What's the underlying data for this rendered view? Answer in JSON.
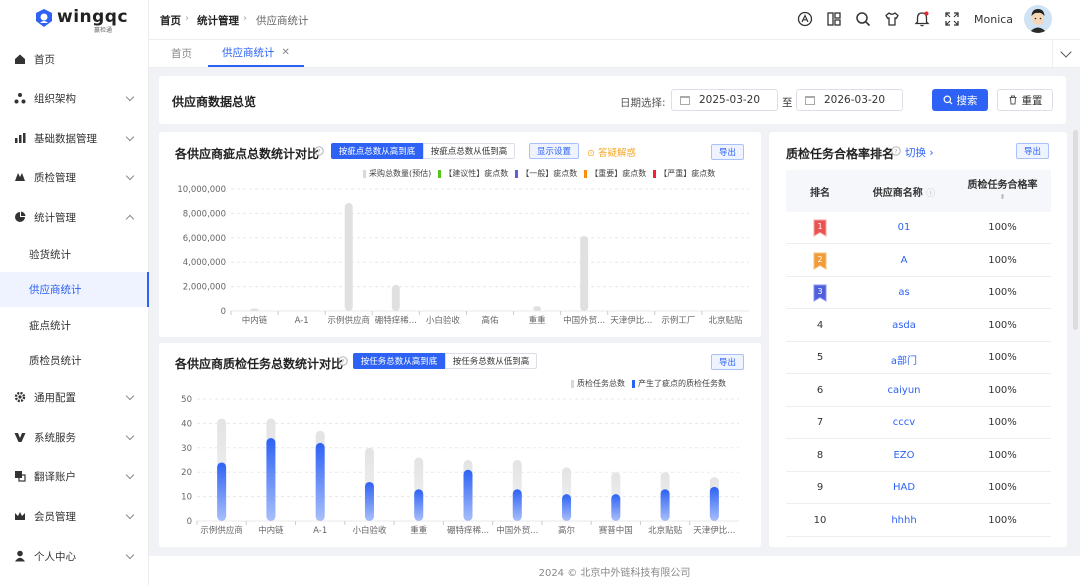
{
  "app": {
    "logo_text": "wingqc",
    "logo_sub": "赢检通"
  },
  "sidebar": {
    "items": [
      {
        "label": "首页",
        "icon": "home-icon"
      },
      {
        "label": "组织架构",
        "icon": "org-icon"
      },
      {
        "label": "基础数据管理",
        "icon": "bar-chart-icon"
      },
      {
        "label": "质检管理",
        "icon": "inspection-icon"
      },
      {
        "label": "统计管理",
        "icon": "pie-chart-icon"
      },
      {
        "label": "通用配置",
        "icon": "gear-icon"
      },
      {
        "label": "系统服务",
        "icon": "service-icon"
      },
      {
        "label": "翻译账户",
        "icon": "translate-icon"
      },
      {
        "label": "会员管理",
        "icon": "crown-icon"
      },
      {
        "label": "个人中心",
        "icon": "user-icon"
      }
    ],
    "sub_items": [
      "验货统计",
      "供应商统计",
      "疵点统计",
      "质检员统计"
    ]
  },
  "topbar": {
    "breadcrumb": [
      "首页",
      "统计管理",
      "供应商统计"
    ],
    "user_name": "Monica"
  },
  "tabs": [
    {
      "label": "首页"
    },
    {
      "label": "供应商统计"
    }
  ],
  "filter": {
    "title": "供应商数据总览",
    "date_label": "日期选择:",
    "start_date": "2025-03-20",
    "to": "至",
    "end_date": "2026-03-20",
    "search_label": "搜索",
    "reset_label": "重置"
  },
  "defect_chart": {
    "title": "各供应商疵点总数统计对比",
    "sort_desc": "按疵点总数从高到底",
    "sort_asc": "按疵点总数从低到高",
    "settings_label": "显示设置",
    "help_label": "答疑解惑",
    "export_label": "导出",
    "legend": [
      {
        "name": "采购总数量(预估)",
        "color": "#d9d9d9"
      },
      {
        "name": "【建议性】疵点数",
        "color": "#52c41a"
      },
      {
        "name": "【一般】疵点数",
        "color": "#5b5fd9"
      },
      {
        "name": "【重要】疵点数",
        "color": "#fa8c16"
      },
      {
        "name": "【严重】疵点数",
        "color": "#f5222d"
      }
    ]
  },
  "task_chart": {
    "title": "各供应商质检任务总数统计对比",
    "sort_desc": "按任务总数从高到底",
    "sort_asc": "按任务总数从低到高",
    "export_label": "导出",
    "legend": [
      {
        "name": "质检任务总数",
        "color": "#d9d9d9"
      },
      {
        "name": "产生了疵点的质检任务数",
        "color": "#2d62f4"
      }
    ]
  },
  "chart_data": [
    {
      "type": "bar",
      "title": "各供应商疵点总数统计对比",
      "categories": [
        "中内链",
        "A-1",
        "示例供应商",
        "硼特痒稀...",
        "小白验收",
        "高佑",
        "重重",
        "中国外贸...",
        "天津伊比...",
        "示例工厂",
        "北京贴贴"
      ],
      "series": [
        {
          "name": "采购总数量(预估)",
          "values": [
            200000,
            0,
            8850000,
            2150000,
            0,
            0,
            400000,
            6150000,
            0,
            0,
            0
          ]
        }
      ],
      "yticks": [
        "10,000,000",
        "8,000,000",
        "6,000,000",
        "4,000,000",
        "2,000,000",
        "0"
      ],
      "ylim": [
        0,
        10000000
      ]
    },
    {
      "type": "bar",
      "title": "各供应商质检任务总数统计对比",
      "categories": [
        "示例供应商",
        "中内链",
        "A-1",
        "小白验收",
        "重重",
        "硼特痒稀...",
        "中国外贸...",
        "高尔",
        "赛普中国",
        "北京贴贴",
        "天津伊比..."
      ],
      "series": [
        {
          "name": "质检任务总数",
          "values": [
            42,
            42,
            37,
            30,
            26,
            25,
            25,
            22,
            20,
            20,
            18
          ]
        },
        {
          "name": "产生了疵点的质检任务数",
          "values": [
            24,
            34,
            32,
            16,
            13,
            21,
            13,
            11,
            11,
            13,
            14
          ]
        }
      ],
      "yticks": [
        "50",
        "40",
        "30",
        "20",
        "10",
        "0"
      ],
      "ylim": [
        0,
        50
      ]
    }
  ],
  "ranking": {
    "title": "质检任务合格率排名",
    "switch_label": "切换",
    "export_label": "导出",
    "headers": [
      "排名",
      "供应商名称",
      "质检任务合格率"
    ],
    "rows": [
      {
        "rank": "1",
        "name": "01",
        "rate": "100%"
      },
      {
        "rank": "2",
        "name": "A",
        "rate": "100%"
      },
      {
        "rank": "3",
        "name": "as",
        "rate": "100%"
      },
      {
        "rank": "4",
        "name": "asda",
        "rate": "100%"
      },
      {
        "rank": "5",
        "name": "a部门",
        "rate": "100%"
      },
      {
        "rank": "6",
        "name": "caiyun",
        "rate": "100%"
      },
      {
        "rank": "7",
        "name": "cccv",
        "rate": "100%"
      },
      {
        "rank": "8",
        "name": "EZO",
        "rate": "100%"
      },
      {
        "rank": "9",
        "name": "HAD",
        "rate": "100%"
      },
      {
        "rank": "10",
        "name": "hhhh",
        "rate": "100%"
      }
    ]
  },
  "footer": {
    "text": "2024 © 北京中外链科技有限公司"
  }
}
